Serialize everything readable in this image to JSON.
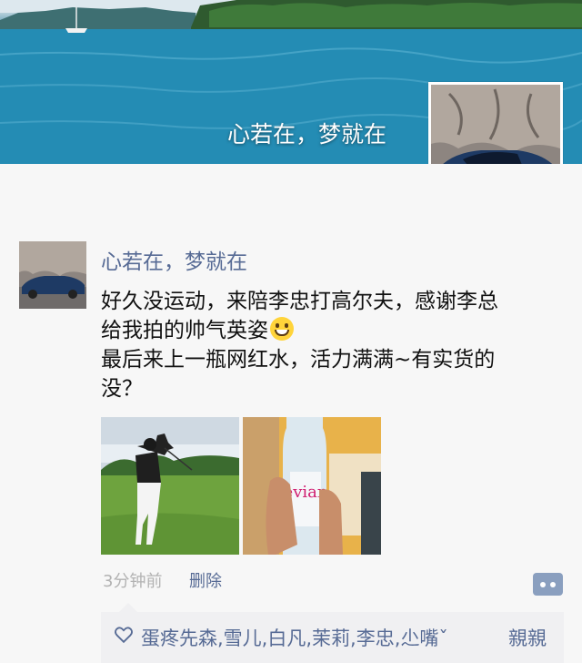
{
  "cover": {
    "name": "心若在，梦就在"
  },
  "post": {
    "author": "心若在，梦就在",
    "text_line1": "好久没运动，来陪李忠打高尔夫，感谢李总",
    "text_line2": "给我拍的帅气英姿",
    "text_line3": "最后来上一瓶网红水，活力满满~有实货的",
    "text_line4": "没？",
    "emoji": "grinning-face-emoji",
    "time": "3分钟前",
    "delete_label": "删除",
    "water_label": "evian"
  },
  "likes": {
    "names": "蛋疼先森,雪儿,白凡,茉莉,李忠,尐嘴ˇ",
    "names_end": "親親"
  },
  "colors": {
    "link": "#576b95",
    "muted": "#b2b2b2",
    "comment_button": "#8a9fbf"
  }
}
